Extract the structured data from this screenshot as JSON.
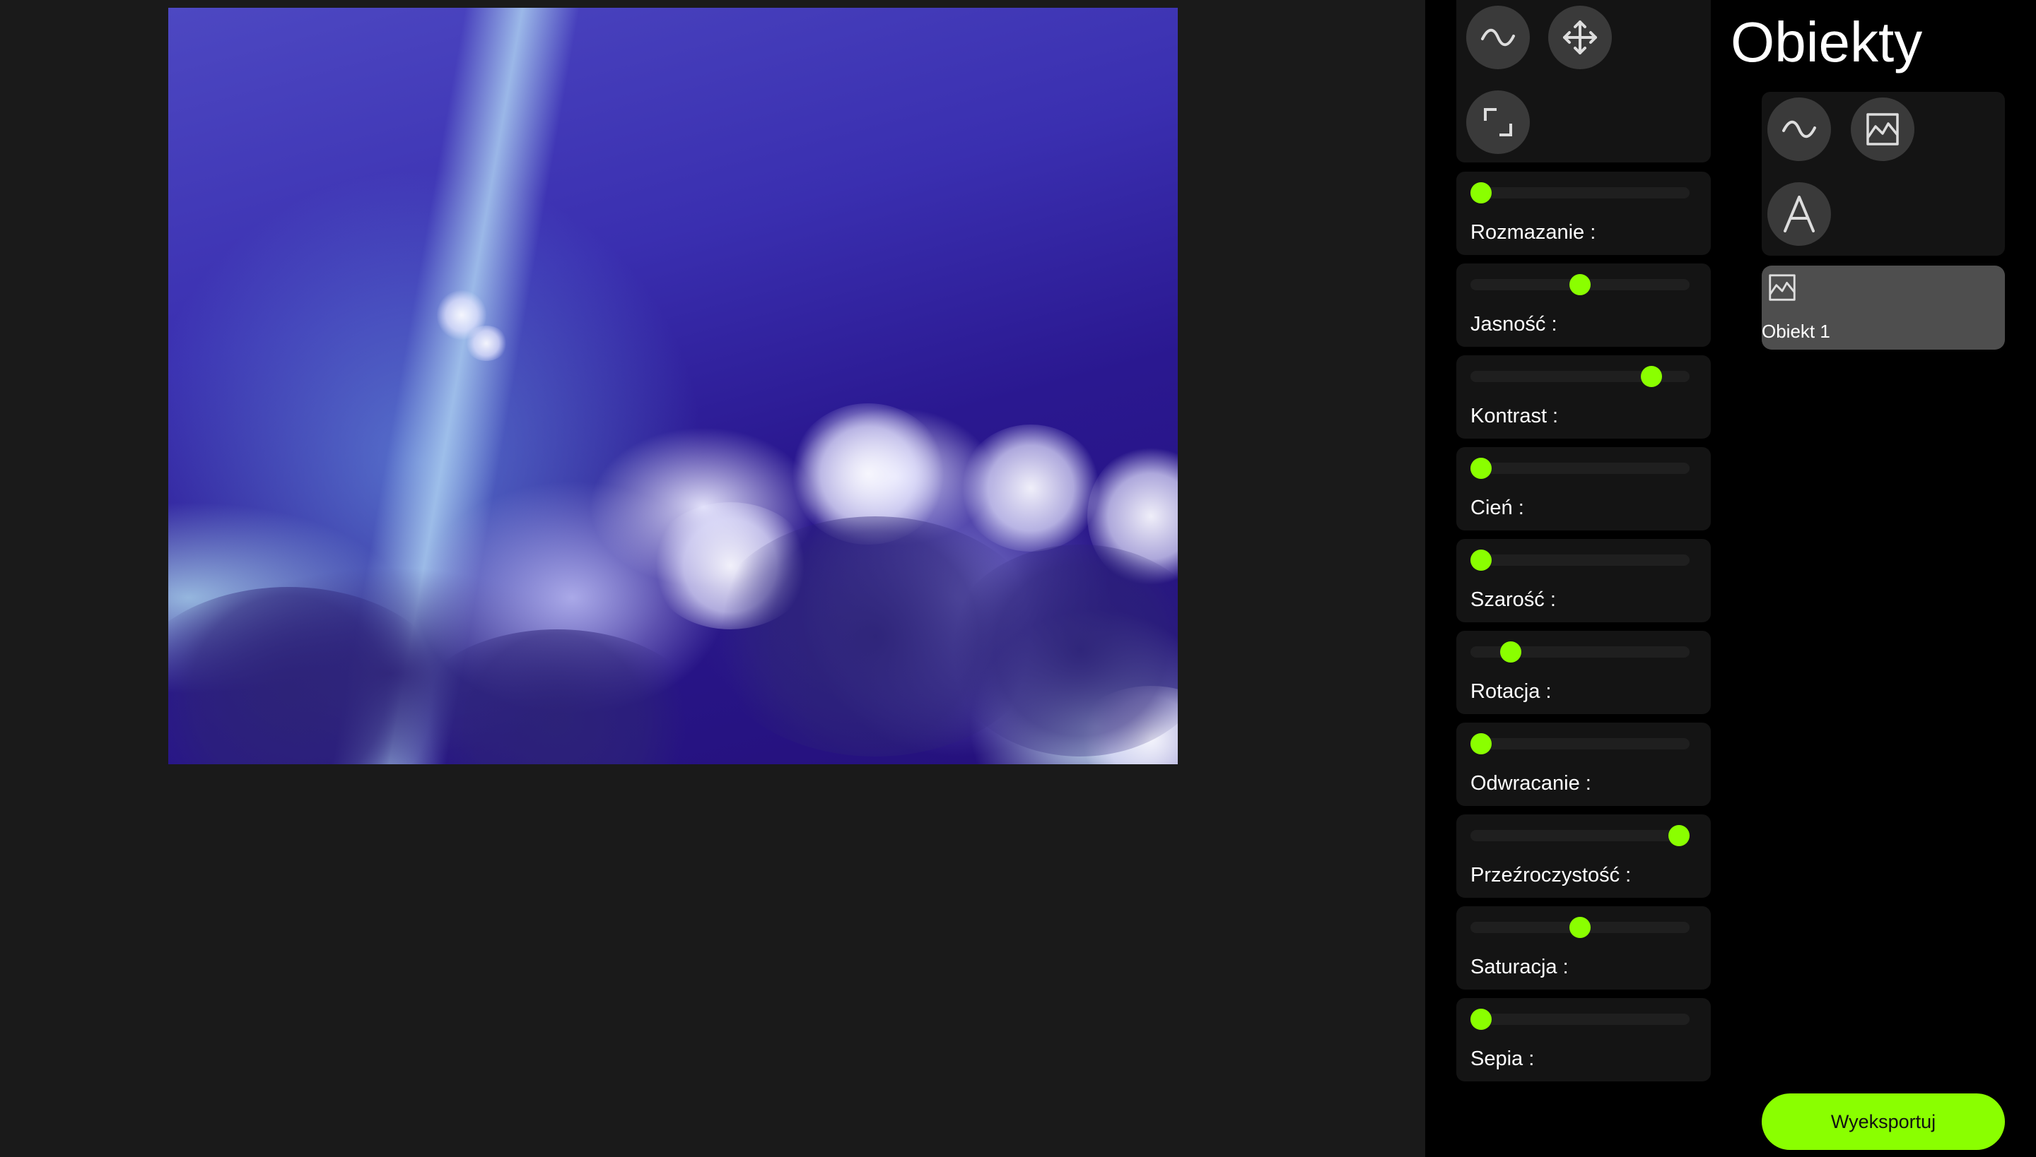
{
  "colors": {
    "background": "#1a1a1a",
    "panel": "#000000",
    "card": "#141414",
    "accent": "#8aff00",
    "button": "#3a3a3a",
    "selected_item": "#4e4e4e"
  },
  "canvas": {
    "image_description_icon": "image-icon"
  },
  "tools": [
    {
      "icon": "wave-icon",
      "name": "draw"
    },
    {
      "icon": "move-icon",
      "name": "move"
    },
    {
      "icon": "crop-icon",
      "name": "crop"
    }
  ],
  "filters": [
    {
      "label": "Rozmazanie :",
      "level": 0.0
    },
    {
      "label": "Jasność :",
      "level": 0.5
    },
    {
      "label": "Kontrast :",
      "level": 0.86
    },
    {
      "label": "Cień :",
      "level": 0.0
    },
    {
      "label": "Szarość :",
      "level": 0.0
    },
    {
      "label": "Rotacja :",
      "level": 0.15
    },
    {
      "label": "Odwracanie :",
      "level": 0.0
    },
    {
      "label": "Przeźroczystość :",
      "level": 1.0
    },
    {
      "label": "Saturacja :",
      "level": 0.5
    },
    {
      "label": "Sepia :",
      "level": 0.0
    }
  ],
  "objects": {
    "title": "Obiekty",
    "add_buttons": [
      {
        "icon": "wave-icon"
      },
      {
        "icon": "image-icon"
      },
      {
        "icon": "text-icon"
      }
    ],
    "items": [
      {
        "name": "Obiekt 1",
        "icon": "image-icon"
      }
    ],
    "export_label": "Wyeksportuj"
  }
}
